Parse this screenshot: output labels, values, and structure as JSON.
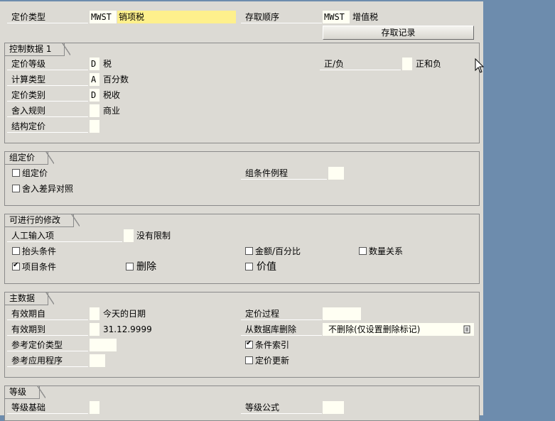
{
  "header": {
    "pricing_type_label": "定价类型",
    "pricing_type_code": "MWST",
    "pricing_type_desc": "销项税",
    "access_seq_label": "存取顺序",
    "access_seq_code": "MWST",
    "access_seq_desc": "增值税",
    "access_record_button": "存取记录"
  },
  "control": {
    "title": "控制数据 1",
    "rows": [
      {
        "label": "定价等级",
        "value": "D",
        "desc": "税"
      },
      {
        "label": "计算类型",
        "value": "A",
        "desc": "百分数"
      },
      {
        "label": "定价类别",
        "value": "D",
        "desc": "税收"
      },
      {
        "label": "舍入规则",
        "value": "",
        "desc": "商业"
      },
      {
        "label": "结构定价",
        "value": "",
        "desc": ""
      }
    ],
    "plus_minus_label": "正/负",
    "plus_minus_value": "",
    "plus_minus_desc": "正和负"
  },
  "group_pricing": {
    "title": "组定价",
    "group_cond_label": "组定价",
    "group_cond_checked": false,
    "rounding_diff_label": "舍入差异对照",
    "rounding_diff_checked": false,
    "group_routine_label": "组条件例程",
    "group_routine_value": ""
  },
  "changes": {
    "title": "可进行的修改",
    "manual_entry_label": "人工输入项",
    "manual_entry_value": "",
    "manual_entry_desc": "没有限制",
    "header_cond_label": "抬头条件",
    "header_cond_checked": false,
    "amount_pct_label": "金额/百分比",
    "amount_pct_checked": false,
    "qty_relation_label": "数量关系",
    "qty_relation_checked": false,
    "item_cond_label": "项目条件",
    "item_cond_checked": true,
    "delete_label": "删除",
    "delete_checked": false,
    "value_label": "价值",
    "value_checked": false
  },
  "master": {
    "title": "主数据",
    "valid_from_label": "有效期自",
    "valid_from_value": "",
    "valid_from_desc": "今天的日期",
    "valid_to_label": "有效期到",
    "valid_to_value": "",
    "valid_to_desc": "31.12.9999",
    "ref_type_label": "参考定价类型",
    "ref_type_value": "",
    "ref_app_label": "参考应用程序",
    "ref_app_value": "",
    "pricing_proc_label": "定价过程",
    "pricing_proc_value": "",
    "db_delete_label": "从数据库删除",
    "db_delete_value": "不删除(仅设置删除标记)",
    "cond_index_label": "条件索引",
    "cond_index_checked": true,
    "pricing_update_label": "定价更新",
    "pricing_update_checked": false
  },
  "scales": {
    "title": "等级",
    "scale_base_label": "等级基础",
    "scale_base_value": "",
    "scale_formula_label": "等级公式",
    "scale_formula_value": ""
  },
  "icons": {
    "dropdown": "list-icon",
    "cursor": "mouse-pointer-icon"
  }
}
